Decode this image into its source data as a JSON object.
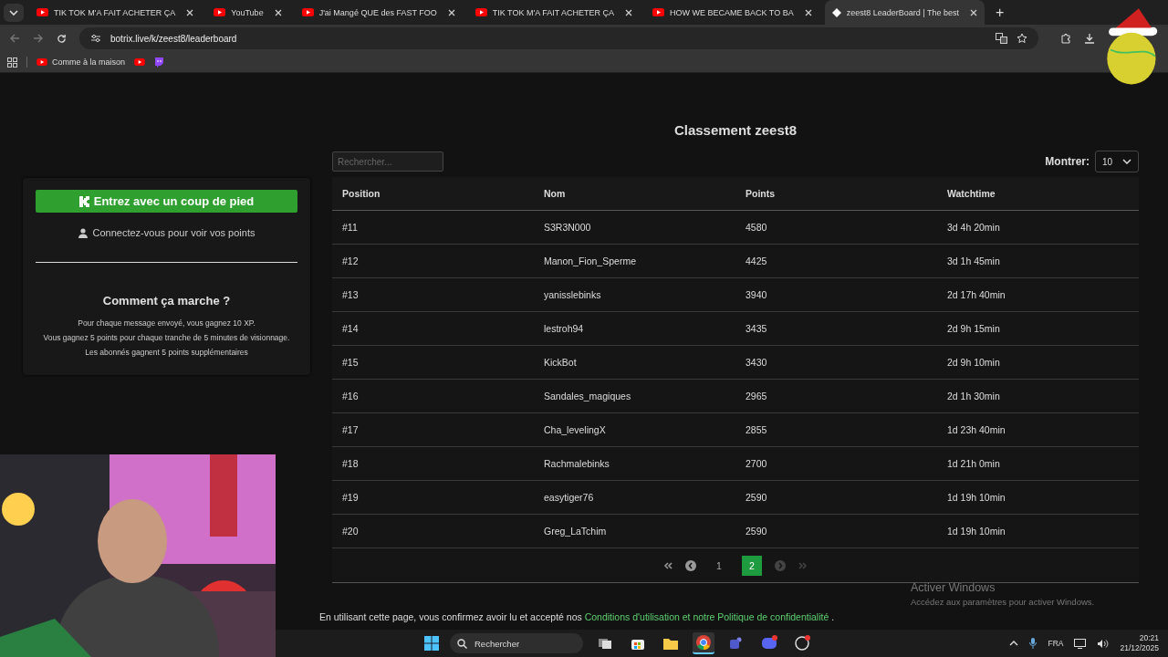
{
  "browser": {
    "tabs": [
      {
        "title": "TIK TOK M'A FAIT ACHETER ÇA",
        "kind": "youtube",
        "selected": false
      },
      {
        "title": "YouTube",
        "kind": "youtube",
        "selected": false
      },
      {
        "title": "J'ai Mangé QUE des FAST FOO",
        "kind": "youtube",
        "selected": false
      },
      {
        "title": "TIK TOK M'A FAIT ACHETER ÇA",
        "kind": "youtube",
        "selected": false
      },
      {
        "title": "HOW WE BECAME BACK TO BA",
        "kind": "youtube",
        "selected": false
      },
      {
        "title": "zeest8 LeaderBoard | The best",
        "kind": "site",
        "selected": true
      }
    ],
    "new_tab": "+",
    "url": "botrix.live/k/zeest8/leaderboard",
    "bookmarks": [
      {
        "label": "Comme à la maison",
        "kind": "youtube"
      },
      {
        "kind": "youtube"
      },
      {
        "kind": "twitch"
      }
    ]
  },
  "sidebar": {
    "login_button": "Entrez avec un coup de pied",
    "login_hint": "Connectez-vous pour voir vos points",
    "how_title": "Comment ça marche ?",
    "rules": [
      "Pour chaque message envoyé, vous gagnez 10 XP.",
      "Vous gagnez 5 points pour chaque tranche de 5 minutes de visionnage.",
      "Les abonnés gagnent 5 points supplémentaires"
    ]
  },
  "leaderboard": {
    "title": "Classement zeest8",
    "search": {
      "placeholder": "Rechercher..."
    },
    "show_label": "Montrer:",
    "show_value": "10",
    "columns": [
      "Position",
      "Nom",
      "Points",
      "Watchtime"
    ],
    "rows": [
      [
        "#11",
        "S3R3N000",
        "4580",
        "3d 4h 20min"
      ],
      [
        "#12",
        "Manon_Fion_Sperme",
        "4425",
        "3d 1h 45min"
      ],
      [
        "#13",
        "yanisslebinks",
        "3940",
        "2d 17h 40min"
      ],
      [
        "#14",
        "lestroh94",
        "3435",
        "2d 9h 15min"
      ],
      [
        "#15",
        "KickBot",
        "3430",
        "2d 9h 10min"
      ],
      [
        "#16",
        "Sandales_magiques",
        "2965",
        "2d 1h 30min"
      ],
      [
        "#17",
        "Cha_levelingX",
        "2855",
        "1d 23h 40min"
      ],
      [
        "#18",
        "Rachmalebinks",
        "2700",
        "1d 21h 0min"
      ],
      [
        "#19",
        "easytiger76",
        "2590",
        "1d 19h 10min"
      ],
      [
        "#20",
        "Greg_LaTchim",
        "2590",
        "1d 19h 10min"
      ]
    ],
    "pager": {
      "first_disabled": false,
      "prev_disabled": false,
      "next_disabled": true,
      "last_disabled": true,
      "pages": [
        {
          "label": "1",
          "selected": false
        },
        {
          "label": "2",
          "selected": true
        }
      ]
    }
  },
  "footer": {
    "text": "En utilisant cette page, vous confirmez avoir lu et accepté nos",
    "link": "Conditions d'utilisation et notre Politique de confidentialité",
    "end": "."
  },
  "activation": {
    "title": "Activer Windows",
    "text": "Accédez aux paramètres pour activer Windows."
  },
  "taskbar": {
    "search": "Rechercher",
    "apps": [
      {
        "kind": "taskview",
        "active": false
      },
      {
        "kind": "store",
        "active": false
      },
      {
        "kind": "folder",
        "active": false
      },
      {
        "kind": "chrome",
        "active": true
      },
      {
        "kind": "teams",
        "active": false
      },
      {
        "kind": "discord",
        "active": false
      },
      {
        "kind": "app",
        "active": false
      }
    ],
    "language": "FRA",
    "time": "20:21",
    "date": "21/12/2025"
  }
}
